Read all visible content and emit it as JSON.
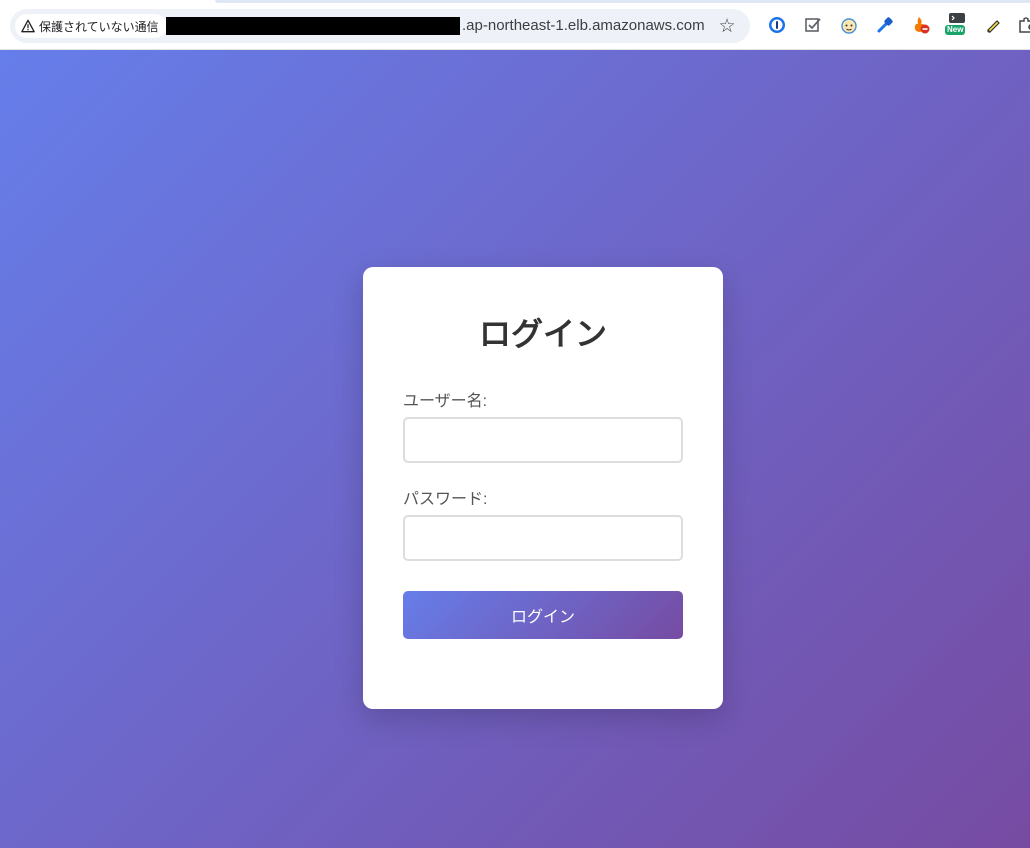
{
  "browser": {
    "security_label": "保護されていない通信",
    "url_visible_suffix": ".ap-northeast-1.elb.amazonaws.com",
    "icons": {
      "warning": "warning-triangle-icon",
      "bookmark": "star-icon",
      "extensions": [
        "1password-icon",
        "checkbox-extension-icon",
        "baby-face-extension-icon",
        "eyedropper-extension-icon",
        "flame-blocker-extension-icon",
        "terminal-new-extension-icon",
        "highlighter-extension-icon",
        "puzzle-extensions-icon"
      ]
    },
    "extension_badge": "New"
  },
  "login": {
    "title": "ログイン",
    "username_label": "ユーザー名:",
    "username_value": "",
    "password_label": "パスワード:",
    "password_value": "",
    "submit_label": "ログイン"
  },
  "colors": {
    "gradient_start": "#667eea",
    "gradient_end": "#764ba2",
    "card_background": "#ffffff",
    "title_text": "#333333",
    "label_text": "#555555",
    "input_border": "#dddddd"
  }
}
